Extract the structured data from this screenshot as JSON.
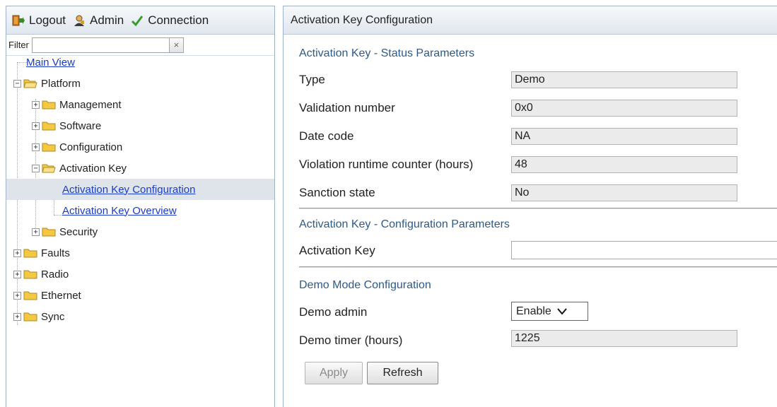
{
  "topbar": {
    "logout_label": "Logout",
    "admin_label": "Admin",
    "connection_label": "Connection"
  },
  "filter": {
    "label": "Filter",
    "value": "",
    "clear_glyph": "×"
  },
  "tree": {
    "main_view": "Main View",
    "platform": "Platform",
    "management": "Management",
    "software": "Software",
    "configuration": "Configuration",
    "activation_key": "Activation Key",
    "activation_key_configuration": "Activation Key Configuration",
    "activation_key_overview": "Activation Key Overview",
    "security": "Security",
    "faults": "Faults",
    "radio": "Radio",
    "ethernet": "Ethernet",
    "sync": "Sync",
    "expand_glyph": "+",
    "collapse_glyph": "−"
  },
  "main": {
    "title": "Activation Key Configuration",
    "status": {
      "heading": "Activation Key - Status Parameters",
      "type_label": "Type",
      "type_value": "Demo",
      "validation_label": "Validation number",
      "validation_value": "0x0",
      "date_label": "Date code",
      "date_value": "NA",
      "violation_label": "Violation runtime counter (hours)",
      "violation_value": "48",
      "sanction_label": "Sanction state",
      "sanction_value": "No"
    },
    "config": {
      "heading": "Activation Key - Configuration Parameters",
      "key_label": "Activation Key",
      "key_value": ""
    },
    "demo": {
      "heading": "Demo Mode Configuration",
      "admin_label": "Demo admin",
      "admin_value": "Enable",
      "timer_label": "Demo timer (hours)",
      "timer_value": "1225"
    },
    "buttons": {
      "apply": "Apply",
      "refresh": "Refresh"
    }
  },
  "colors": {
    "link": "#1a3cc8",
    "section_title": "#2f5a86",
    "folder": "#f5c842"
  }
}
